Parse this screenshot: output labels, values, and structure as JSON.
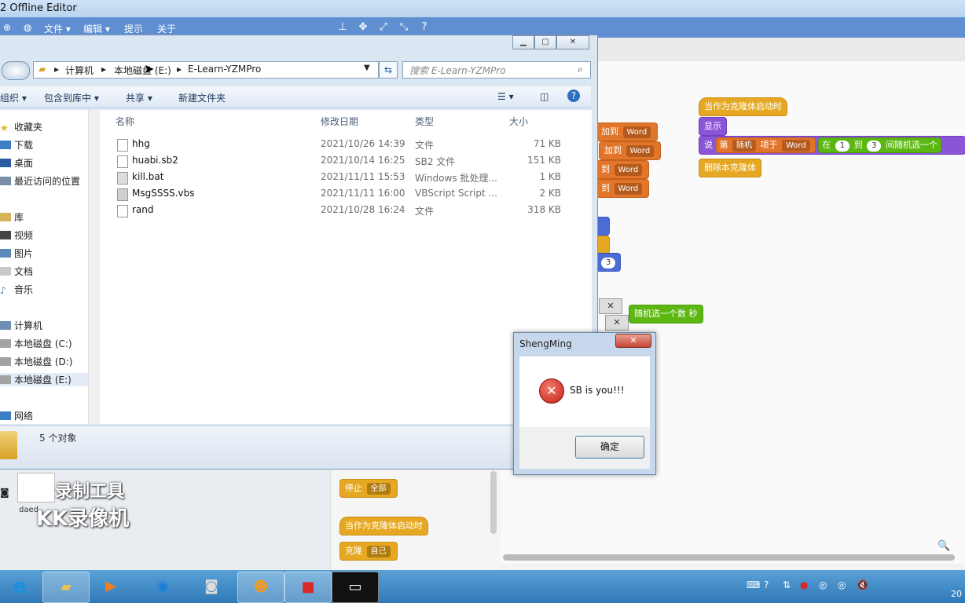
{
  "scratch": {
    "title": "2 Offline Editor",
    "menu": [
      "文件 ▾",
      "编辑 ▾",
      "提示",
      "关于"
    ],
    "tool_icons": [
      "stamp-icon",
      "cross-arrows-icon",
      "grow-icon",
      "shrink-icon",
      "help-icon"
    ],
    "blocks": {
      "hat_clone": "当作为克隆体启动时",
      "show": "显示",
      "say_prefix": "说",
      "say_item_prefix": "第",
      "say_random": "随机",
      "say_item_of": "项于",
      "say_list": "Word",
      "say_in": "在",
      "say_from": "1",
      "say_to_label": "到",
      "say_to": "3",
      "say_pick": "间随机选一个",
      "delete_clone": "删除本克隆体",
      "add_to_1": "加到",
      "add_word_1": "Word",
      "add_to_2": "加到",
      "add_word_2": "Word",
      "add_to_3": "到",
      "add_word_3": "Word",
      "add_to_4": "到",
      "add_word_4": "Word",
      "num_3": "3",
      "pick_random": "随机选一个数",
      "sec": "秒",
      "stop_label": "停止",
      "stop_all": "全部",
      "hat_clone_2": "当作为克隆体启动时",
      "clone_label": "克隆",
      "clone_self": "自己"
    },
    "x_marks": [
      "✕",
      "✕"
    ]
  },
  "explorer": {
    "caption_buttons": [
      "▁",
      "▢",
      "✕"
    ],
    "breadcrumb": [
      "计算机",
      "本地磁盘 (E:)",
      "E-Learn-YZMPro"
    ],
    "search_placeholder": "搜索 E-Learn-YZMPro",
    "commands": [
      "组织 ▾",
      "包含到库中 ▾",
      "共享 ▾",
      "新建文件夹"
    ],
    "nav": [
      {
        "label": "收藏夹",
        "icon": "star-icon"
      },
      {
        "label": "下载",
        "icon": "download-folder-icon"
      },
      {
        "label": "桌面",
        "icon": "desktop-icon"
      },
      {
        "label": "最近访问的位置",
        "icon": "recent-places-icon"
      },
      {
        "label": "库",
        "icon": "library-icon"
      },
      {
        "label": "视频",
        "icon": "video-icon"
      },
      {
        "label": "图片",
        "icon": "pictures-icon"
      },
      {
        "label": "文档",
        "icon": "documents-icon"
      },
      {
        "label": "音乐",
        "icon": "music-icon"
      },
      {
        "label": "计算机",
        "icon": "computer-icon"
      },
      {
        "label": "本地磁盘 (C:)",
        "icon": "drive-icon"
      },
      {
        "label": "本地磁盘 (D:)",
        "icon": "drive-icon"
      },
      {
        "label": "本地磁盘 (E:)",
        "icon": "drive-icon"
      },
      {
        "label": "网络",
        "icon": "network-icon"
      }
    ],
    "columns": [
      "名称",
      "修改日期",
      "类型",
      "大小"
    ],
    "files": [
      {
        "name": "hhg",
        "date": "2021/10/26 14:39",
        "type": "文件",
        "size": "71 KB"
      },
      {
        "name": "huabi.sb2",
        "date": "2021/10/14 16:25",
        "type": "SB2 文件",
        "size": "151 KB"
      },
      {
        "name": "kill.bat",
        "date": "2021/11/11 15:53",
        "type": "Windows 批处理...",
        "size": "1 KB"
      },
      {
        "name": "MsgSSSS.vbs",
        "date": "2021/11/11 16:00",
        "type": "VBScript Script ...",
        "size": "2 KB"
      },
      {
        "name": "rand",
        "date": "2021/10/28 16:24",
        "type": "文件",
        "size": "318 KB"
      }
    ],
    "status": "5 个对象"
  },
  "dialog": {
    "title": "ShengMing",
    "message": "SB is you!!!",
    "ok": "确定",
    "close": "✕"
  },
  "watermark": {
    "line1": "录制工具",
    "line2": "KK录像机"
  },
  "desktop_file": "daed",
  "taskbar": {
    "apps": [
      "ie-icon",
      "explorer-icon",
      "media-player-icon",
      "browser-icon",
      "camera-icon",
      "scratch-cat-icon",
      "app-icon",
      "cmd-icon"
    ],
    "clock": "20"
  }
}
